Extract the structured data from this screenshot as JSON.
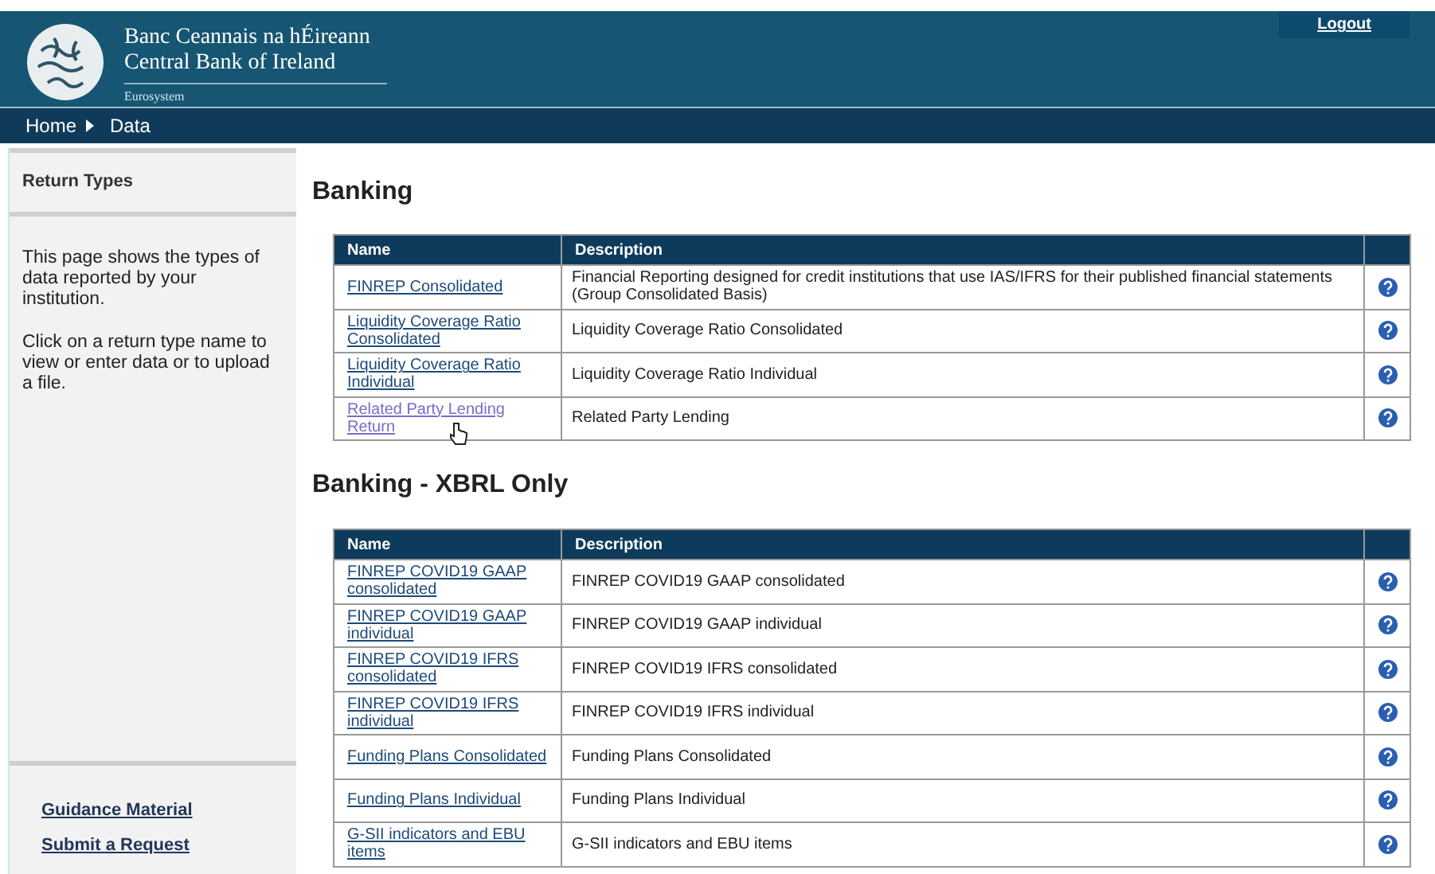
{
  "header": {
    "title_irish": "Banc Ceannais na hÉireann",
    "title_english": "Central Bank of Ireland",
    "subtitle": "Eurosystem",
    "logout": "Logout"
  },
  "breadcrumb": [
    {
      "label": "Home"
    },
    {
      "label": "Data"
    }
  ],
  "sidebar": {
    "heading": "Return Types",
    "paragraphs": [
      "This page shows the types of data reported by your institution.",
      "Click on a return type name to view or enter data or to upload a file."
    ],
    "links": [
      "Guidance Material",
      "Submit a Request"
    ]
  },
  "sections": [
    {
      "title": "Banking",
      "columns": [
        "Name",
        "Description"
      ],
      "rows": [
        {
          "name": "FINREP Consolidated",
          "description": "Financial Reporting designed for credit institutions that use IAS/IFRS for their published financial statements (Group Consolidated Basis)",
          "hovered": false
        },
        {
          "name": "Liquidity Coverage Ratio Consolidated",
          "description": "Liquidity Coverage Ratio Consolidated",
          "hovered": false
        },
        {
          "name": "Liquidity Coverage Ratio Individual",
          "description": "Liquidity Coverage Ratio Individual",
          "hovered": false
        },
        {
          "name": "Related Party Lending Return",
          "description": "Related Party Lending",
          "hovered": true
        }
      ]
    },
    {
      "title": "Banking - XBRL Only",
      "columns": [
        "Name",
        "Description"
      ],
      "rows": [
        {
          "name": "FINREP COVID19 GAAP consolidated",
          "description": "FINREP COVID19 GAAP consolidated",
          "hovered": false
        },
        {
          "name": "FINREP COVID19 GAAP individual",
          "description": "FINREP COVID19 GAAP individual",
          "hovered": false
        },
        {
          "name": "FINREP COVID19 IFRS consolidated",
          "description": "FINREP COVID19 IFRS consolidated",
          "hovered": false
        },
        {
          "name": "FINREP COVID19 IFRS individual",
          "description": "FINREP COVID19 IFRS individual",
          "hovered": false
        },
        {
          "name": "Funding Plans Consolidated",
          "description": "Funding Plans Consolidated",
          "hovered": false
        },
        {
          "name": "Funding Plans Individual",
          "description": "Funding Plans Individual",
          "hovered": false
        },
        {
          "name": "G-SII indicators and EBU items",
          "description": "G-SII indicators and EBU items",
          "hovered": false
        }
      ]
    }
  ]
}
